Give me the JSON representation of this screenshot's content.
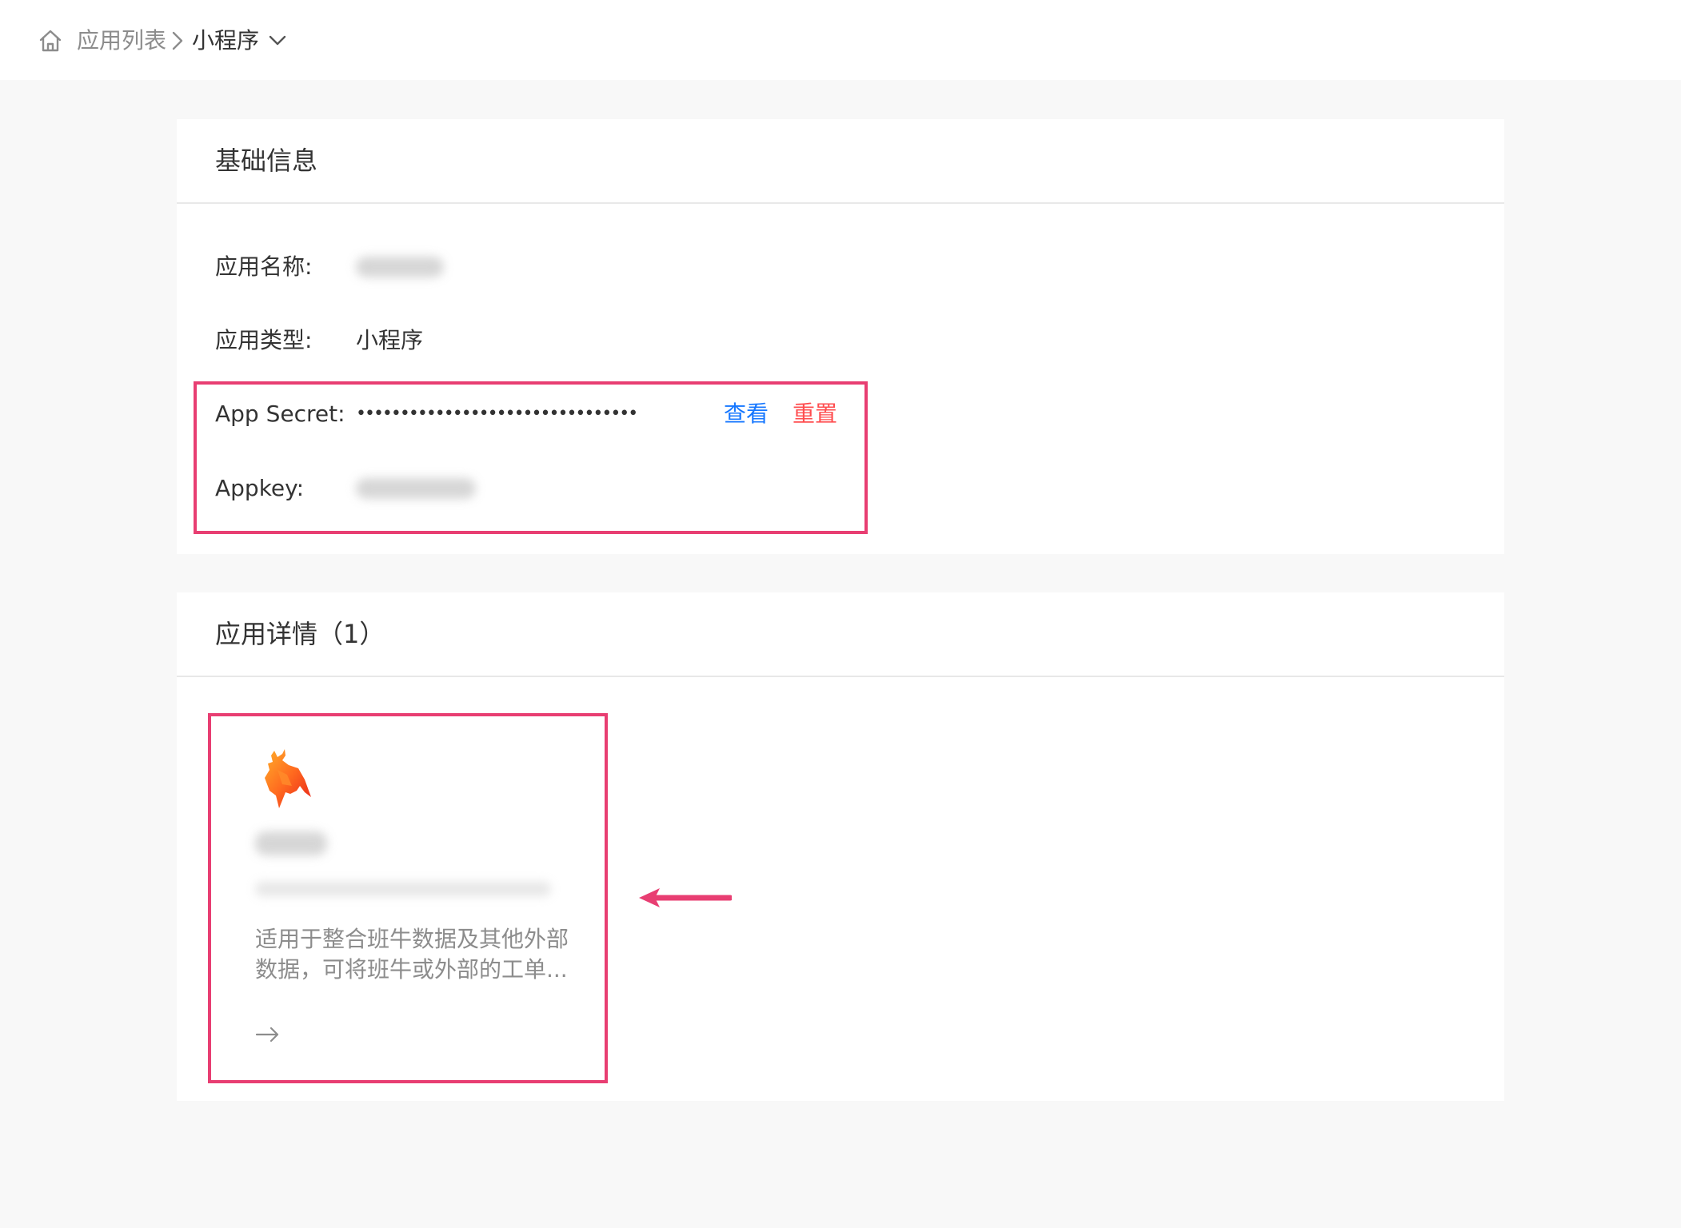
{
  "breadcrumb": {
    "home_icon": "home-icon",
    "parent": "应用列表",
    "separator_icon": "chevron-right-icon",
    "current": "小程序",
    "dropdown_icon": "chevron-down-icon"
  },
  "basic_info": {
    "title": "基础信息",
    "fields": {
      "app_name": {
        "label": "应用名称:",
        "value_hidden": true
      },
      "app_type": {
        "label": "应用类型:",
        "value": "小程序"
      },
      "app_secret": {
        "label": "App Secret:",
        "value": "••••••••••••••••••••••••••••••••",
        "view_label": "查看",
        "reset_label": "重置"
      },
      "appkey": {
        "label": "Appkey:",
        "value_hidden": true
      }
    }
  },
  "app_detail": {
    "title": "应用详情（1）",
    "card": {
      "logo_icon": "bull-logo-icon",
      "description_line1": "适用于整合班牛数据及其他外部",
      "description_line2": "数据，可将班牛或外部的工单...",
      "arrow_icon": "arrow-right-icon"
    }
  },
  "colors": {
    "link_blue": "#1677ff",
    "danger_red": "#ff4d4f",
    "highlight": "#e83e72",
    "logo_orange": "#ff5a1f"
  }
}
